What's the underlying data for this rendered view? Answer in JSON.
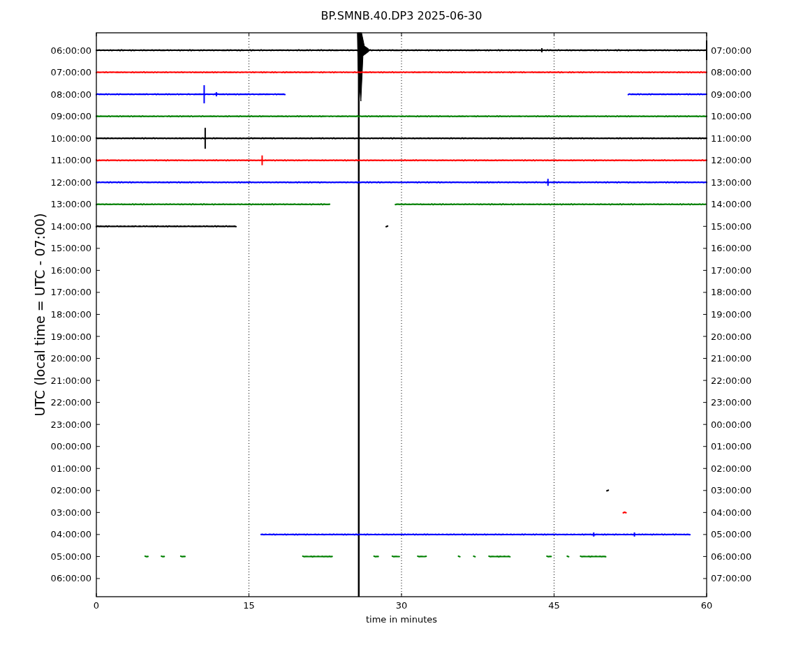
{
  "title": "BP.SMNB.40.DP3 2025-06-30",
  "ylabel": "UTC (local time = UTC - 07:00)",
  "xlabel": "time in minutes",
  "xticks": [
    "0",
    "15",
    "30",
    "45",
    "60"
  ],
  "rows": [
    {
      "left": "06:00:00",
      "right": "07:00:00",
      "color": "#000000"
    },
    {
      "left": "07:00:00",
      "right": "08:00:00",
      "color": "#ff0000"
    },
    {
      "left": "08:00:00",
      "right": "09:00:00",
      "color": "#0000ff"
    },
    {
      "left": "09:00:00",
      "right": "10:00:00",
      "color": "#008000"
    },
    {
      "left": "10:00:00",
      "right": "11:00:00",
      "color": "#000000"
    },
    {
      "left": "11:00:00",
      "right": "12:00:00",
      "color": "#ff0000"
    },
    {
      "left": "12:00:00",
      "right": "13:00:00",
      "color": "#0000ff"
    },
    {
      "left": "13:00:00",
      "right": "14:00:00",
      "color": "#008000"
    },
    {
      "left": "14:00:00",
      "right": "15:00:00",
      "color": "#000000"
    },
    {
      "left": "15:00:00",
      "right": "16:00:00"
    },
    {
      "left": "16:00:00",
      "right": "17:00:00"
    },
    {
      "left": "17:00:00",
      "right": "18:00:00"
    },
    {
      "left": "18:00:00",
      "right": "19:00:00"
    },
    {
      "left": "19:00:00",
      "right": "20:00:00"
    },
    {
      "left": "20:00:00",
      "right": "21:00:00"
    },
    {
      "left": "21:00:00",
      "right": "22:00:00"
    },
    {
      "left": "22:00:00",
      "right": "23:00:00"
    },
    {
      "left": "23:00:00",
      "right": "00:00:00"
    },
    {
      "left": "00:00:00",
      "right": "01:00:00"
    },
    {
      "left": "01:00:00",
      "right": "02:00:00"
    },
    {
      "left": "02:00:00",
      "right": "03:00:00",
      "color": "#000000"
    },
    {
      "left": "03:00:00",
      "right": "04:00:00",
      "color": "#ff0000"
    },
    {
      "left": "04:00:00",
      "right": "05:00:00",
      "color": "#0000ff"
    },
    {
      "left": "05:00:00",
      "right": "06:00:00",
      "color": "#008000"
    },
    {
      "left": "06:00:00",
      "right": "07:00:00"
    }
  ]
}
